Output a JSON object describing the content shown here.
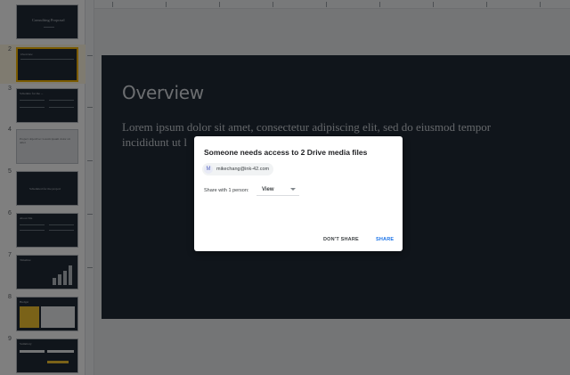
{
  "filmstrip": {
    "slides": [
      {
        "num": "",
        "title": "Consulting Proposal"
      },
      {
        "num": "2",
        "title": "Overview"
      },
      {
        "num": "3",
        "title": "Schedule for the ..."
      },
      {
        "num": "4",
        "title": "Project objective: Lorem ipsum dolor sit amet"
      },
      {
        "num": "5",
        "title": "Scheduled for the project"
      },
      {
        "num": "6",
        "title": "About Me"
      },
      {
        "num": "7",
        "title": "Timeline"
      },
      {
        "num": "8",
        "title": "Budget"
      },
      {
        "num": "9",
        "title": "Summary"
      }
    ]
  },
  "slide": {
    "title": "Overview",
    "body": "Lorem ipsum dolor sit amet, consectetur adipiscing elit, sed do eiusmod tempor incididunt ut l"
  },
  "dialog": {
    "title": "Someone needs access to 2 Drive media files",
    "chip_avatar": "M",
    "chip_email": "mikechang@ink-42.com",
    "share_label": "Share with 1 person:",
    "permission": "View",
    "dont_share": "DON'T SHARE",
    "share": "SHARE"
  },
  "colors": {
    "slide_bg": "#202a36",
    "accent_yellow": "#f4b400",
    "share_blue": "#1a73e8"
  }
}
